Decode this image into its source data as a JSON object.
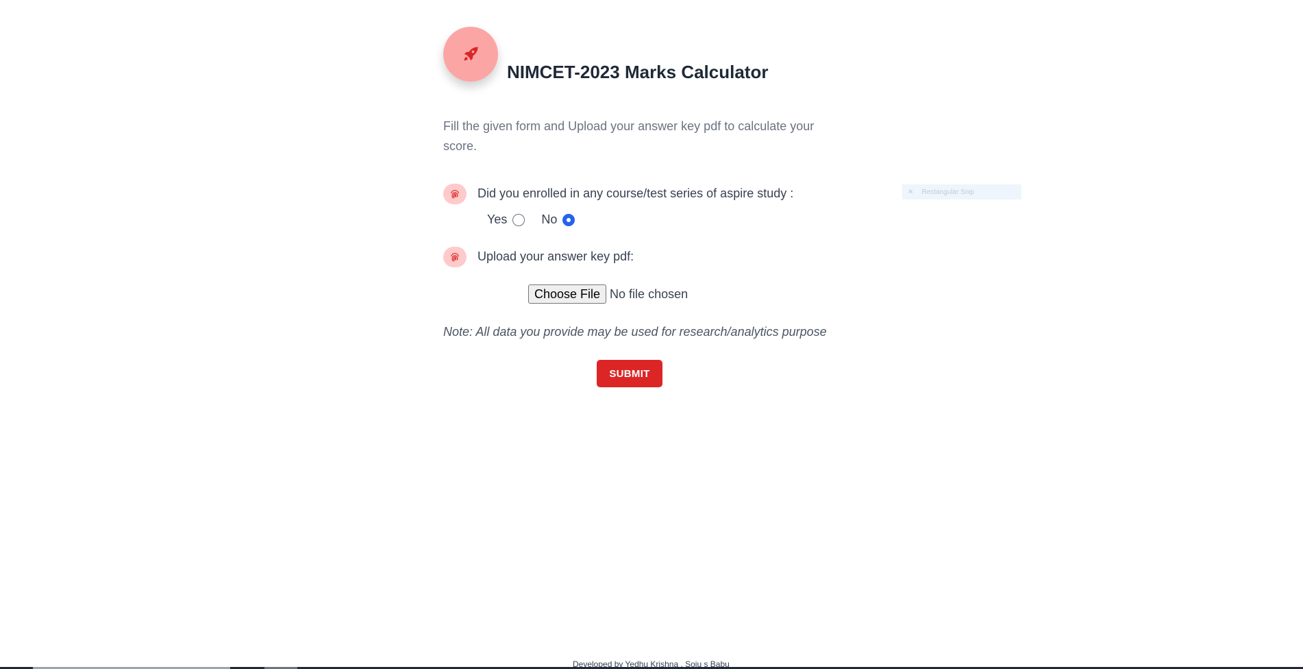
{
  "header": {
    "title": "NIMCET-2023 Marks Calculator",
    "logo_icon": "rocket-icon"
  },
  "intro": {
    "text": "Fill the given form and Upload your answer key pdf to calculate your score."
  },
  "form": {
    "question1": {
      "label": "Did you enrolled in any course/test series of aspire study :",
      "icon": "fingerprint-icon",
      "options": [
        {
          "label": "Yes",
          "checked": false
        },
        {
          "label": "No",
          "checked": true
        }
      ]
    },
    "question2": {
      "label": "Upload your answer key pdf:",
      "icon": "fingerprint-icon",
      "button_label": "Choose File",
      "file_status": "No file chosen"
    },
    "note": "Note: All data you provide may be used for research/analytics purpose",
    "submit_label": "SUBMIT"
  },
  "overlay": {
    "snip_label": "Rectangular Snip"
  },
  "footer": {
    "text": "Developed by Yedhu Krishna , Soju s Babu"
  },
  "colors": {
    "accent": "#dc2626",
    "logo_bg": "#fca5a5",
    "icon_bg": "#fecaca",
    "radio_checked": "#2563eb"
  }
}
